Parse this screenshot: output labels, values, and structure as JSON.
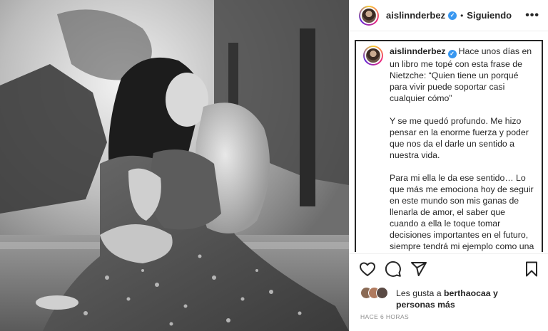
{
  "post": {
    "username": "aislinnderbez",
    "following_label": "Siguiendo",
    "separator": "•",
    "more_label": "•••"
  },
  "caption": {
    "username": "aislinnderbez",
    "paragraphs": [
      "Hace unos días en un libro me topé con esta frase de Nietzche: “Quien tiene un porqué para vivir puede soportar casi cualquier cómo”",
      "Y se me quedó profundo. Me hizo pensar en la enorme fuerza y poder que nos da el darle un sentido a nuestra vida.",
      "Para mi ella le da ese sentido… Lo que más me emociona hoy de seguir en este mundo son mis ganas de llenarla de amor, el saber que cuando a ella le toque tomar decisiones importantes en el futuro, siempre tendrá mi ejemplo como una opción, y dejarle eso es mi mayor responsabilidad que"
    ]
  },
  "actions": {
    "like_icon": "heart-icon",
    "comment_icon": "comment-icon",
    "share_icon": "share-icon",
    "save_icon": "bookmark-icon"
  },
  "likes": {
    "prefix": "Les gusta a ",
    "user": "berthaocaa",
    "suffix": " y personas más"
  },
  "timestamp": "HACE 6 HORAS",
  "colors": {
    "verified": "#3897f0",
    "text": "#262626",
    "muted": "#8e8e8e"
  }
}
